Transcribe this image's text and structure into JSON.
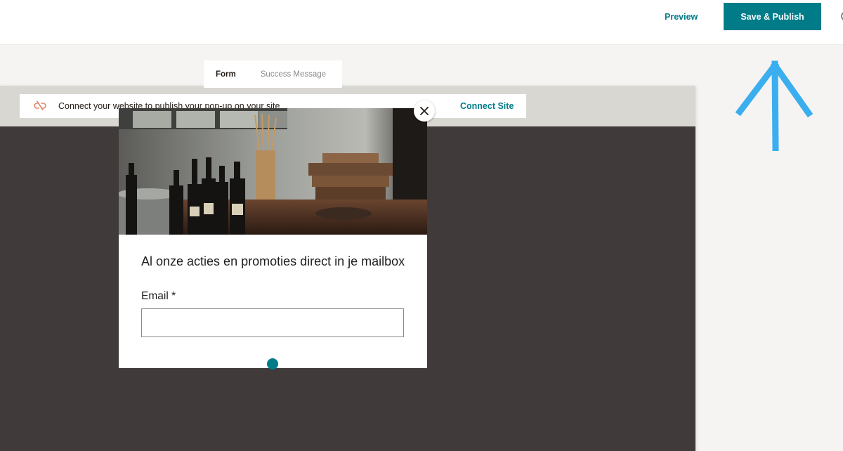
{
  "topbar": {
    "preview_label": "Preview",
    "publish_label": "Save & Publish"
  },
  "connect_bar": {
    "message": "Connect your website to publish your pop-up on your site",
    "action_label": "Connect Site"
  },
  "tabs": [
    {
      "label": "Form",
      "active": true
    },
    {
      "label": "Success Message",
      "active": false
    }
  ],
  "popup": {
    "heading": "Al onze acties en promoties direct in je mailbox",
    "email_label": "Email *",
    "email_value": "",
    "close_icon": "close-icon"
  },
  "colors": {
    "accent": "#007c89",
    "frame_dark": "#403a3a",
    "frame_header": "#d9d7d1",
    "annotation_arrow": "#3aaeee",
    "unlink_icon": "#e8866b"
  }
}
